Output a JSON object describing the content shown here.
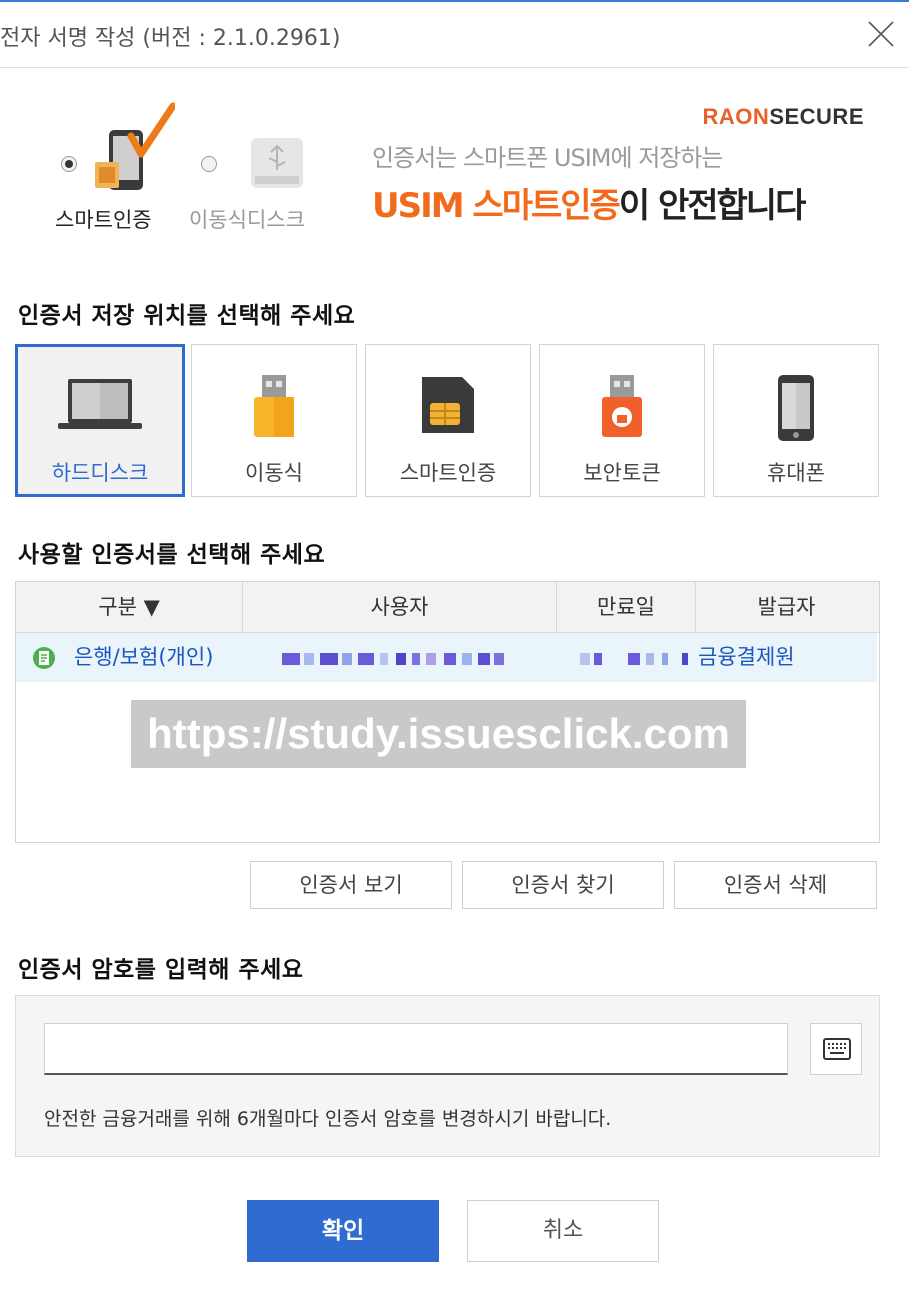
{
  "window": {
    "title": "전자 서명 작성 (버전 : 2.1.0.2961)"
  },
  "media_options": [
    {
      "label": "스마트인증",
      "selected": true,
      "icon": "smartphone-check-icon"
    },
    {
      "label": "이동식디스크",
      "selected": false,
      "icon": "usb-drive-icon"
    }
  ],
  "banner": {
    "brand_prefix": "RAON",
    "brand_suffix": "SECURE",
    "subtitle": "인증서는 스마트폰 USIM에 저장하는",
    "headline_highlight": "USIM 스마트인증",
    "headline_rest": "이 안전합니다",
    "colors": {
      "brand": "#e8612c",
      "highlight": "#f26a1b"
    }
  },
  "location_section": {
    "heading": "인증서 저장 위치를 선택해 주세요",
    "tiles": [
      {
        "label": "하드디스크",
        "icon": "laptop-icon",
        "selected": true
      },
      {
        "label": "이동식",
        "icon": "usb-drive-icon",
        "selected": false
      },
      {
        "label": "스마트인증",
        "icon": "sim-card-icon",
        "selected": false
      },
      {
        "label": "보안토큰",
        "icon": "security-token-icon",
        "selected": false
      },
      {
        "label": "휴대폰",
        "icon": "mobile-phone-icon",
        "selected": false
      }
    ]
  },
  "cert_section": {
    "heading": "사용할 인증서를 선택해 주세요",
    "columns": [
      "구분 ▼",
      "사용자",
      "만료일",
      "발급자"
    ],
    "rows": [
      {
        "type": "은행/보험(개인)",
        "user": "",
        "expiry": "",
        "issuer": "금융결제원",
        "icon": "certificate-doc-icon"
      }
    ],
    "watermark": "https://study.issuesclick.com"
  },
  "cert_buttons": {
    "view": "인증서 보기",
    "find": "인증서 찾기",
    "delete": "인증서 삭제"
  },
  "password_section": {
    "heading": "인증서 암호를 입력해 주세요",
    "input_value": "",
    "note": "안전한 금융거래를 위해 6개월마다 인증서 암호를 변경하시기 바랍니다."
  },
  "actions": {
    "confirm": "확인",
    "cancel": "취소"
  },
  "colors": {
    "accent": "#2f6bd0",
    "row_highlight": "#eaf5fb"
  }
}
